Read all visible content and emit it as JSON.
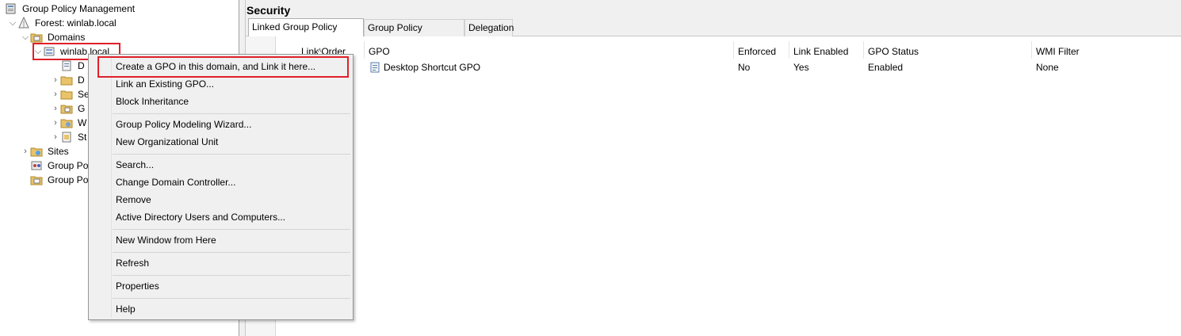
{
  "tree": {
    "root": "Group Policy Management",
    "forest": "Forest: winlab.local",
    "domains": "Domains",
    "domain": "winlab.local",
    "children": [
      "D",
      "D",
      "Se",
      "G",
      "W",
      "St"
    ],
    "sites": "Sites",
    "gp_modeling": "Group Po",
    "gp_results": "Group Po"
  },
  "right": {
    "title": "Security",
    "tabs": [
      "Linked Group Policy Objects",
      "Group Policy Inheritance",
      "Delegation"
    ],
    "columns": [
      "Link Order",
      "GPO",
      "Enforced",
      "Link Enabled",
      "GPO Status",
      "WMI Filter"
    ],
    "rows": [
      {
        "gpo": "Desktop Shortcut GPO",
        "enforced": "No",
        "link_enabled": "Yes",
        "status": "Enabled",
        "wmi": "None"
      }
    ]
  },
  "context_menu": {
    "items": [
      "Create a GPO in this domain, and Link it here...",
      "Link an Existing GPO...",
      "Block Inheritance",
      "Group Policy Modeling Wizard...",
      "New Organizational Unit",
      "Search...",
      "Change Domain Controller...",
      "Remove",
      "Active Directory Users and Computers...",
      "New Window from Here",
      "Refresh",
      "Properties",
      "Help"
    ]
  },
  "colors": {
    "highlight": "#e0202a",
    "menu_bg": "#f0f0f0",
    "pane_bg": "#f0f0f0"
  }
}
